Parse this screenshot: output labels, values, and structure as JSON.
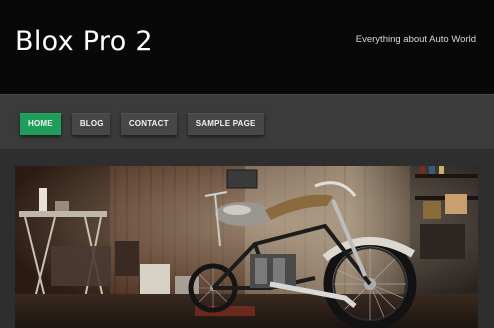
{
  "header": {
    "site_title": "Blox Pro 2",
    "tagline": "Everything about Auto World"
  },
  "nav": {
    "items": [
      {
        "label": "HOME",
        "active": true
      },
      {
        "label": "BLOG",
        "active": false
      },
      {
        "label": "CONTACT",
        "active": false
      },
      {
        "label": "SAMPLE PAGE",
        "active": false
      }
    ]
  },
  "colors": {
    "header_bg": "#080808",
    "nav_bg": "#3b3b3b",
    "accent": "#1e9e5a"
  },
  "featured_image": {
    "subject": "motorcycle-in-garage-photo"
  }
}
